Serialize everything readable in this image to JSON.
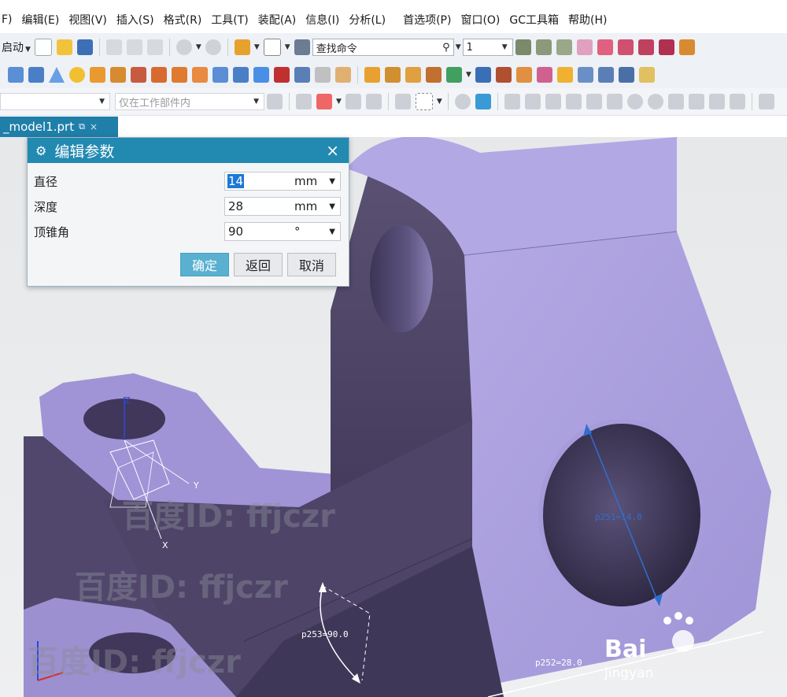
{
  "menu": [
    "F)",
    "编辑(E)",
    "视图(V)",
    "插入(S)",
    "格式(R)",
    "工具(T)",
    "装配(A)",
    "信息(I)",
    "分析(L)",
    "首选项(P)",
    "窗口(O)",
    "GC工具箱",
    "帮助(H)"
  ],
  "toolbar": {
    "start_label": "启动",
    "command_search_value": "查找命令",
    "level_value": "1",
    "selection_scope_value": "仅在工作部件内"
  },
  "tab": {
    "file_name": "_model1.prt",
    "close_glyph": "×"
  },
  "dialog": {
    "title": "编辑参数",
    "close_glyph": "×",
    "params": [
      {
        "label": "直径",
        "value": "14",
        "unit": "mm"
      },
      {
        "label": "深度",
        "value": "28",
        "unit": "mm"
      },
      {
        "label": "顶锥角",
        "value": "90",
        "unit": "°"
      }
    ],
    "buttons": {
      "ok": "确定",
      "back": "返回",
      "cancel": "取消"
    }
  },
  "viewport": {
    "dimensions": {
      "diameter": "p251=14.0",
      "tip_angle": "p253=90.0",
      "depth": "p252=28.0"
    },
    "axes": {
      "z": "Z",
      "y": "Y",
      "x": "X"
    },
    "watermark": "百度ID: ffjczr",
    "logo_text": "Bai",
    "logo_sub": "jingyan"
  },
  "colors": {
    "menu_accent": "#1f7fa8",
    "dialog_title": "#2289b1",
    "ok_button": "#59b0d0",
    "part_light": "#a99fd9",
    "part_dark": "#5a5078",
    "dimension_blue": "#2f6fd0"
  }
}
